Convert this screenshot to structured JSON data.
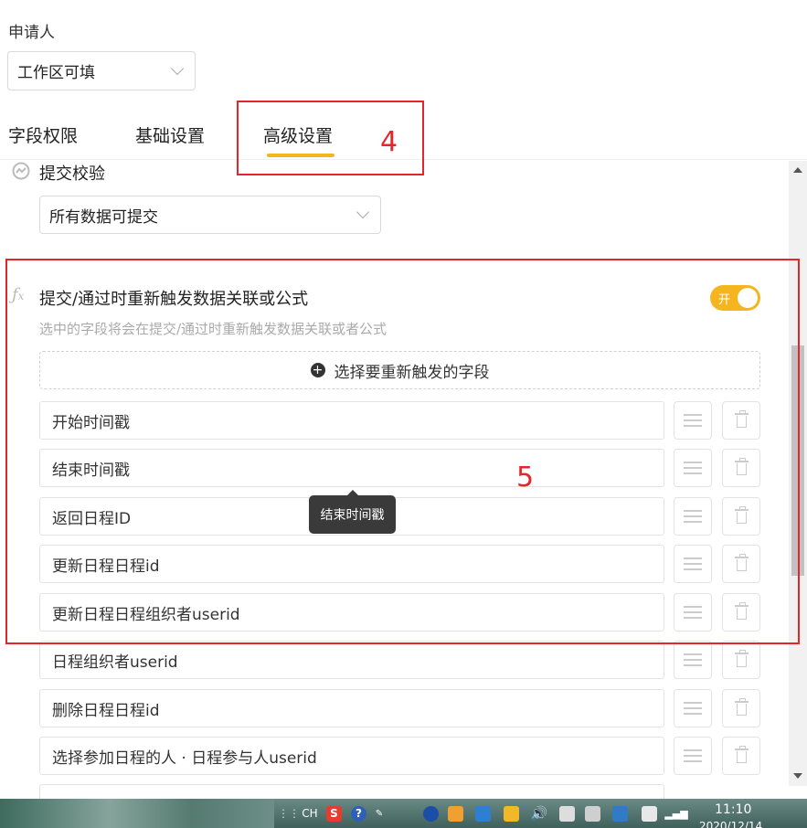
{
  "applicant": {
    "label": "申请人",
    "select_value": "工作区可填"
  },
  "tabs": [
    {
      "label": "字段权限"
    },
    {
      "label": "基础设置"
    },
    {
      "label": "高级设置",
      "active": true
    }
  ],
  "annotations": {
    "box4_number": "4",
    "box5_number": "5"
  },
  "submit_validation": {
    "title": "提交校验",
    "select_value": "所有数据可提交"
  },
  "retrigger": {
    "title": "提交/通过时重新触发数据关联或公式",
    "description": "选中的字段将会在提交/通过时重新触发数据关联或者公式",
    "toggle_label": "开",
    "add_field_label": "选择要重新触发的字段",
    "fields": [
      "开始时间戳",
      "结束时间戳",
      "返回日程ID",
      "更新日程日程id",
      "更新日程日程组织者userid",
      "日程组织者userid",
      "删除日程日程id",
      "选择参加日程的人 · 日程参与人userid"
    ],
    "tooltip": "结束时间戳"
  },
  "taskbar": {
    "lang": "CH",
    "time": "11:10",
    "date": "2020/12/14"
  },
  "colors": {
    "accent": "#f5b51f",
    "annotation_red": "#e4262a"
  }
}
